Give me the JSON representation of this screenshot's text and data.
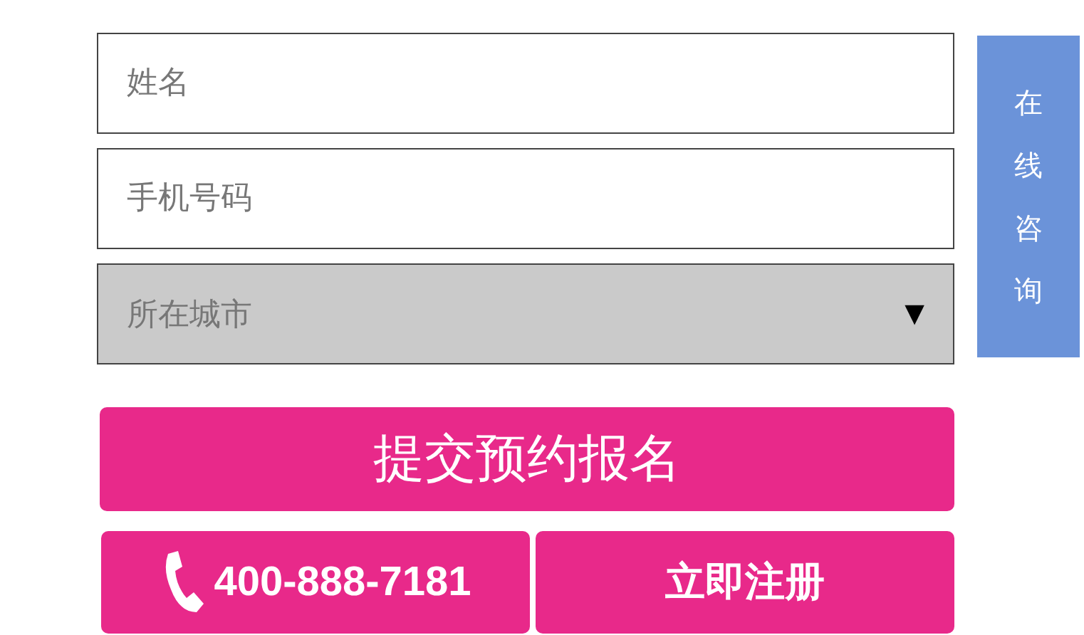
{
  "form": {
    "fields": [
      {
        "kind": "text",
        "placeholder": "姓名"
      },
      {
        "kind": "text",
        "placeholder": "手机号码"
      },
      {
        "kind": "select",
        "placeholder": "所在城市",
        "arrow": "▼"
      }
    ],
    "submit": "提交预约报名",
    "hotline": "400-888-7181",
    "register": "立即注册"
  },
  "side_button": "在线咨询"
}
